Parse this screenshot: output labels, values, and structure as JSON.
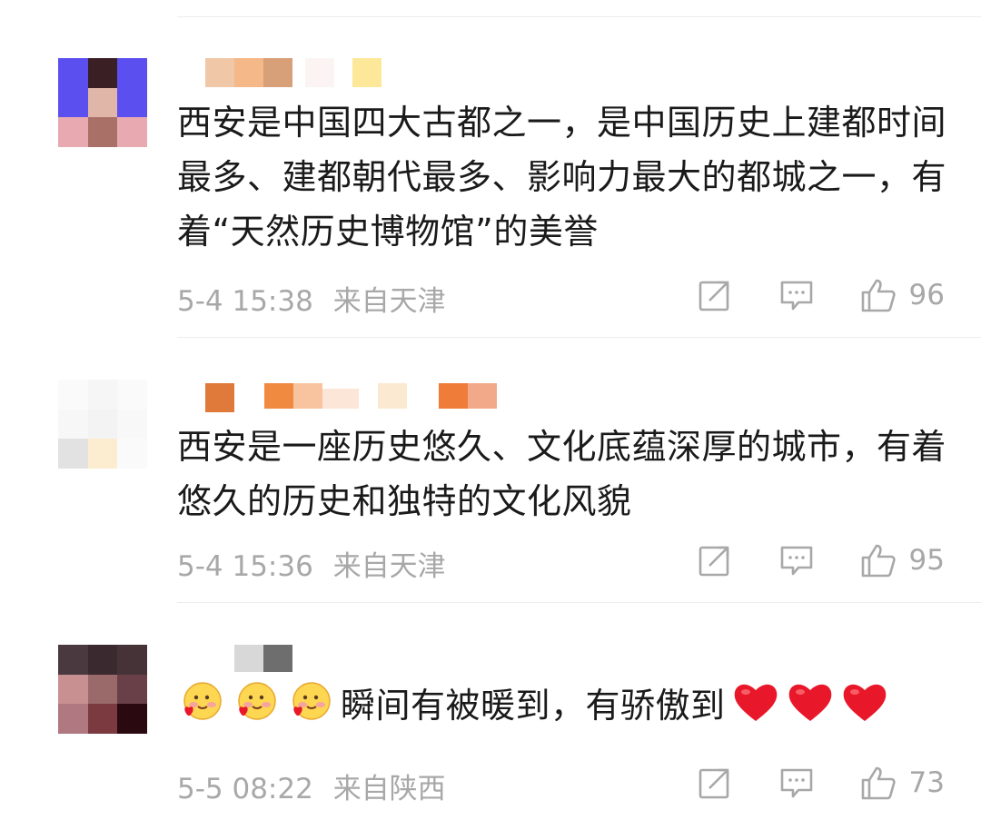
{
  "comments": [
    {
      "text": "西安是中国四大古都之一，是中国历史上建都时间最多、建都朝代最多、影响力最大的都城之一，有着“天然历史博物馆”的美誉",
      "time": "5-4 15:38",
      "location": "来自天津",
      "likes": "96"
    },
    {
      "text": "西安是一座历史悠久、文化底蕴深厚的城市，有着悠久的历史和独特的文化风貌",
      "time": "5-4 15:36",
      "location": "来自天津",
      "likes": "95"
    },
    {
      "text": "瞬间有被暖到，有骄傲到",
      "time": "5-5 08:22",
      "location": "来自陕西",
      "likes": "73",
      "emoji_prefix": [
        "blush-heart-emoji",
        "blush-heart-emoji",
        "blush-heart-emoji"
      ],
      "emoji_suffix": [
        "red-heart-emoji",
        "red-heart-emoji",
        "red-heart-emoji"
      ]
    }
  ],
  "icons": {
    "repost": "repost-icon",
    "comment": "comment-icon",
    "like": "thumbs-up-icon"
  },
  "colors": {
    "text": "#1a1a1a",
    "meta": "#a8a8a8",
    "divider": "#ececec",
    "heart": "#e8182a"
  }
}
